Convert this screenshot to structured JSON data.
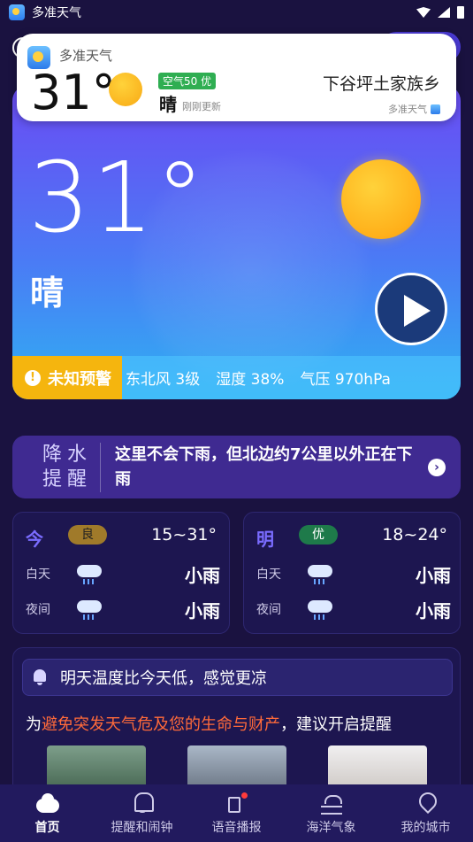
{
  "status_bar": {
    "app_name": "多准天气"
  },
  "notification": {
    "app_name": "多准天气",
    "temperature": "31°",
    "aqi": "空气50 优",
    "condition": "晴",
    "updated": "刚刚更新",
    "location": "下谷坪土家族乡",
    "source": "多准天气"
  },
  "hero": {
    "temperature": "31°",
    "condition": "晴",
    "alert": "未知预警",
    "wind": "东北风 3级",
    "humidity": "湿度 38%",
    "pressure": "气压 970hPa",
    "colors": {
      "gradient_top": "#6a4bf3",
      "gradient_bottom": "#2fb0f2",
      "alert": "#f5b50e"
    }
  },
  "precipitation": {
    "tag_line1": "降水",
    "tag_line2": "提醒",
    "message": "这里不会下雨，但北边约7公里以外正在下雨",
    "arrow": "›"
  },
  "forecast": [
    {
      "day": "今",
      "aqi": "良",
      "range": "15~31°",
      "day_label": "白天",
      "day_weather": "小雨",
      "night_label": "夜间",
      "night_weather": "小雨"
    },
    {
      "day": "明",
      "aqi": "优",
      "range": "18~24°",
      "day_label": "白天",
      "day_weather": "小雨",
      "night_label": "夜间",
      "night_weather": "小雨"
    }
  ],
  "reminder": {
    "headline": "明天温度比今天低，感觉更凉",
    "message_prefix": "为",
    "message_highlight": "避免突发天气危及您的生命与财产",
    "message_suffix": "，建议开启提醒"
  },
  "tabs": [
    {
      "label": "首页",
      "icon": "cloud-icon"
    },
    {
      "label": "提醒和闹钟",
      "icon": "bell-icon"
    },
    {
      "label": "语音播报",
      "icon": "speaker-icon"
    },
    {
      "label": "海洋气象",
      "icon": "sea-icon"
    },
    {
      "label": "我的城市",
      "icon": "location-pin-icon"
    }
  ]
}
